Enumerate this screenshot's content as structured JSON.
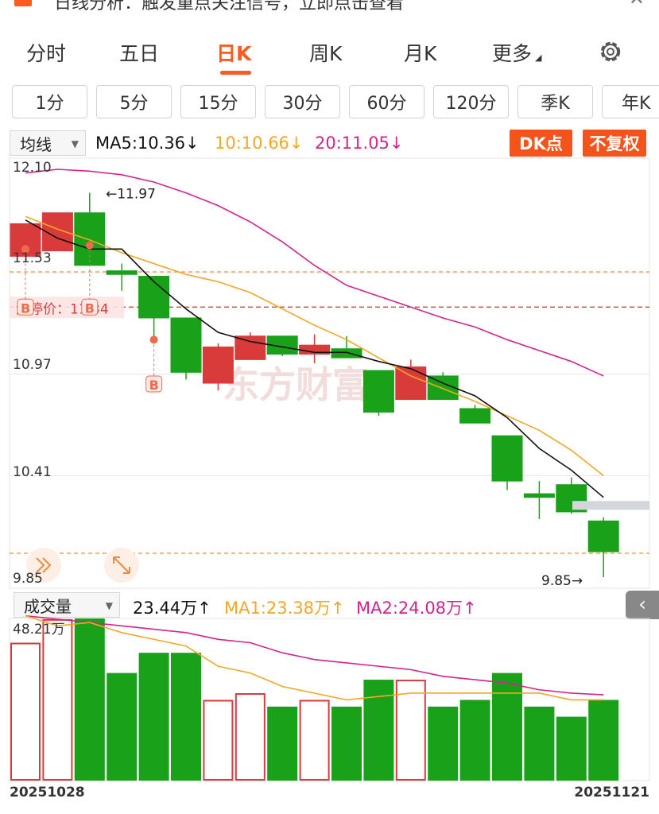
{
  "notice": {
    "text": "日线分析：触发重点关注信号，立即点击查看"
  },
  "tabs": [
    {
      "label": "分时",
      "active": false
    },
    {
      "label": "五日",
      "active": false
    },
    {
      "label": "日K",
      "active": true
    },
    {
      "label": "周K",
      "active": false
    },
    {
      "label": "月K",
      "active": false
    },
    {
      "label": "更多",
      "active": false
    }
  ],
  "minute_buttons": [
    "1分",
    "5分",
    "15分",
    "30分",
    "60分",
    "120分",
    "季K",
    "年K"
  ],
  "main_header": {
    "indicator": "均线",
    "ma5": "MA5:10.36",
    "ma10": "10:10.66",
    "ma20": "20:11.05",
    "arrow_down": "↓",
    "dk_button": "DK点",
    "fq_button": "不复权"
  },
  "annotations": {
    "high_label": "←11.97",
    "low_label": "9.85→",
    "stop_price_label": "涨停价：11.34",
    "buy_marker": "B",
    "watermark": "东方财富"
  },
  "volume_header": {
    "indicator": "成交量",
    "vol": "23.44万",
    "ma1": "MA1:23.38万",
    "ma2": "MA2:24.08万",
    "arrow_up": "↑"
  },
  "colors": {
    "up": "#d93a3a",
    "down": "#1aa11a",
    "ma5": "#111111",
    "ma10": "#f5a623",
    "ma20": "#d6238a",
    "accent": "#ff5a1f"
  },
  "chart_data": {
    "type": "candlestick",
    "price_axis_labels": [
      "12.10",
      "11.53",
      "10.97",
      "10.41",
      "9.85"
    ],
    "price_range": [
      9.85,
      12.1
    ],
    "volume_axis_label": "48.21万",
    "volume_range": [
      0,
      48.21
    ],
    "date_labels": [
      "20251028",
      "20251121"
    ],
    "candles": [
      {
        "open": 11.62,
        "close": 11.8,
        "high": 11.8,
        "low": 11.62,
        "up": true
      },
      {
        "open": 11.65,
        "close": 11.86,
        "high": 11.86,
        "low": 11.65,
        "up": true
      },
      {
        "open": 11.86,
        "close": 11.57,
        "high": 11.97,
        "low": 11.57,
        "up": false
      },
      {
        "open": 11.54,
        "close": 11.52,
        "high": 11.58,
        "low": 11.43,
        "up": false
      },
      {
        "open": 11.51,
        "close": 11.28,
        "high": 11.51,
        "low": 11.15,
        "up": false
      },
      {
        "open": 11.28,
        "close": 10.98,
        "high": 11.28,
        "low": 10.94,
        "up": false
      },
      {
        "open": 10.92,
        "close": 11.12,
        "high": 11.14,
        "low": 10.88,
        "up": true
      },
      {
        "open": 11.05,
        "close": 11.18,
        "high": 11.2,
        "low": 11.05,
        "up": true
      },
      {
        "open": 11.18,
        "close": 11.08,
        "high": 11.18,
        "low": 11.07,
        "up": false
      },
      {
        "open": 11.08,
        "close": 11.13,
        "high": 11.19,
        "low": 11.03,
        "up": true
      },
      {
        "open": 11.11,
        "close": 11.06,
        "high": 11.18,
        "low": 11.06,
        "up": false
      },
      {
        "open": 10.99,
        "close": 10.76,
        "high": 10.99,
        "low": 10.74,
        "up": false
      },
      {
        "open": 10.83,
        "close": 11.01,
        "high": 11.05,
        "low": 10.83,
        "up": true
      },
      {
        "open": 10.96,
        "close": 10.83,
        "high": 10.98,
        "low": 10.83,
        "up": false
      },
      {
        "open": 10.78,
        "close": 10.7,
        "high": 10.8,
        "low": 10.7,
        "up": false
      },
      {
        "open": 10.63,
        "close": 10.38,
        "high": 10.63,
        "low": 10.33,
        "up": false
      },
      {
        "open": 10.31,
        "close": 10.29,
        "high": 10.38,
        "low": 10.17,
        "up": false
      },
      {
        "open": 10.36,
        "close": 10.21,
        "high": 10.4,
        "low": 10.2,
        "up": false
      },
      {
        "open": 10.16,
        "close": 9.99,
        "high": 10.18,
        "low": 9.85,
        "up": false
      }
    ],
    "ma5": [
      11.82,
      11.72,
      11.66,
      11.66,
      11.48,
      11.33,
      11.2,
      11.15,
      11.12,
      11.09,
      11.09,
      11.04,
      11.0,
      10.92,
      10.85,
      10.73,
      10.56,
      10.44,
      10.29
    ],
    "ma10": [
      11.84,
      11.77,
      11.71,
      11.64,
      11.58,
      11.52,
      11.48,
      11.42,
      11.33,
      11.24,
      11.16,
      11.06,
      10.96,
      10.89,
      10.82,
      10.74,
      10.66,
      10.55,
      10.41
    ],
    "ma20": [
      12.08,
      12.1,
      12.09,
      12.07,
      12.03,
      11.97,
      11.9,
      11.81,
      11.7,
      11.57,
      11.46,
      11.4,
      11.34,
      11.28,
      11.23,
      11.16,
      11.1,
      11.04,
      10.96
    ],
    "volumes": [
      41,
      48,
      48.21,
      32,
      38,
      38,
      24,
      26,
      22,
      24,
      22,
      30,
      30,
      22,
      24,
      32,
      22,
      19,
      24
    ],
    "vol_ma1": [
      49,
      46,
      47,
      44,
      42,
      40,
      34,
      32,
      28,
      26,
      24,
      25,
      26,
      26,
      26,
      26,
      26,
      24,
      24
    ],
    "vol_ma2": [
      49,
      48,
      47,
      46,
      45,
      44,
      42,
      41,
      38,
      36,
      35,
      34,
      33,
      31,
      30,
      29,
      27,
      26,
      25.5
    ]
  }
}
